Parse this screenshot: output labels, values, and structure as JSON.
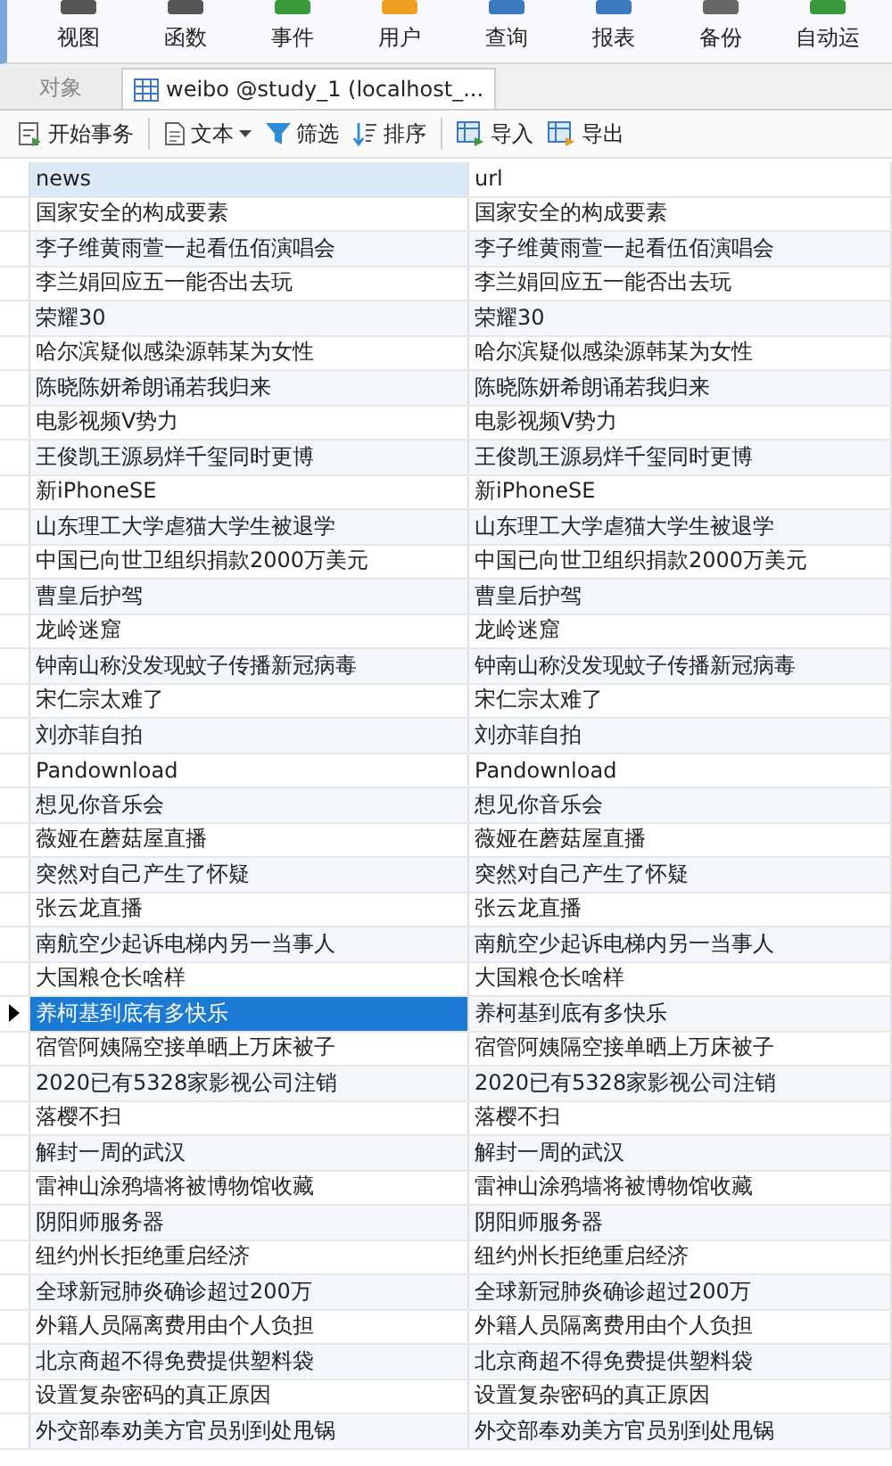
{
  "main_toolbar": [
    {
      "label": "视图"
    },
    {
      "label": "函数"
    },
    {
      "label": "事件"
    },
    {
      "label": "用户"
    },
    {
      "label": "查询"
    },
    {
      "label": "报表"
    },
    {
      "label": "备份"
    },
    {
      "label": "自动运"
    }
  ],
  "tabs": [
    {
      "label": "对象",
      "selected": false
    },
    {
      "label": "weibo @study_1 (localhost_...",
      "selected": true
    }
  ],
  "table_toolbar": [
    {
      "label": "开始事务",
      "kind": "transaction"
    },
    {
      "label": "文本",
      "kind": "text"
    },
    {
      "label": "筛选",
      "kind": "filter"
    },
    {
      "label": "排序",
      "kind": "sort"
    },
    {
      "label": "导入",
      "kind": "import"
    },
    {
      "label": "导出",
      "kind": "export"
    }
  ],
  "table": {
    "columns": [
      {
        "label": "news",
        "selected": true
      },
      {
        "label": "url",
        "selected": false
      }
    ],
    "rows": [
      {
        "cells": [
          "国家安全的构成要素",
          "国家安全的构成要素"
        ],
        "selected": false
      },
      {
        "cells": [
          "李子维黄雨萱一起看伍佰演唱会",
          "李子维黄雨萱一起看伍佰演唱会"
        ],
        "selected": false
      },
      {
        "cells": [
          "李兰娟回应五一能否出去玩",
          "李兰娟回应五一能否出去玩"
        ],
        "selected": false
      },
      {
        "cells": [
          "荣耀30",
          "荣耀30"
        ],
        "selected": false
      },
      {
        "cells": [
          "哈尔滨疑似感染源韩某为女性",
          "哈尔滨疑似感染源韩某为女性"
        ],
        "selected": false
      },
      {
        "cells": [
          "陈晓陈妍希朗诵若我归来",
          "陈晓陈妍希朗诵若我归来"
        ],
        "selected": false
      },
      {
        "cells": [
          "电影视频V势力",
          "电影视频V势力"
        ],
        "selected": false
      },
      {
        "cells": [
          "王俊凯王源易烊千玺同时更博",
          "王俊凯王源易烊千玺同时更博"
        ],
        "selected": false
      },
      {
        "cells": [
          "新iPhoneSE",
          "新iPhoneSE"
        ],
        "selected": false
      },
      {
        "cells": [
          "山东理工大学虐猫大学生被退学",
          "山东理工大学虐猫大学生被退学"
        ],
        "selected": false
      },
      {
        "cells": [
          "中国已向世卫组织捐款2000万美元",
          "中国已向世卫组织捐款2000万美元"
        ],
        "selected": false
      },
      {
        "cells": [
          "曹皇后护驾",
          "曹皇后护驾"
        ],
        "selected": false
      },
      {
        "cells": [
          "龙岭迷窟",
          "龙岭迷窟"
        ],
        "selected": false
      },
      {
        "cells": [
          "钟南山称没发现蚊子传播新冠病毒",
          "钟南山称没发现蚊子传播新冠病毒"
        ],
        "selected": false
      },
      {
        "cells": [
          "宋仁宗太难了",
          "宋仁宗太难了"
        ],
        "selected": false
      },
      {
        "cells": [
          "刘亦菲自拍",
          "刘亦菲自拍"
        ],
        "selected": false
      },
      {
        "cells": [
          "Pandownload",
          "Pandownload"
        ],
        "selected": false
      },
      {
        "cells": [
          "想见你音乐会",
          "想见你音乐会"
        ],
        "selected": false
      },
      {
        "cells": [
          "薇娅在蘑菇屋直播",
          "薇娅在蘑菇屋直播"
        ],
        "selected": false
      },
      {
        "cells": [
          "突然对自己产生了怀疑",
          "突然对自己产生了怀疑"
        ],
        "selected": false
      },
      {
        "cells": [
          "张云龙直播",
          "张云龙直播"
        ],
        "selected": false
      },
      {
        "cells": [
          "南航空少起诉电梯内另一当事人",
          "南航空少起诉电梯内另一当事人"
        ],
        "selected": false
      },
      {
        "cells": [
          "大国粮仓长啥样",
          "大国粮仓长啥样"
        ],
        "selected": false
      },
      {
        "cells": [
          "养柯基到底有多快乐",
          "养柯基到底有多快乐"
        ],
        "selected": true
      },
      {
        "cells": [
          "宿管阿姨隔空接单晒上万床被子",
          "宿管阿姨隔空接单晒上万床被子"
        ],
        "selected": false
      },
      {
        "cells": [
          "2020已有5328家影视公司注销",
          "2020已有5328家影视公司注销"
        ],
        "selected": false
      },
      {
        "cells": [
          "落樱不扫",
          "落樱不扫"
        ],
        "selected": false
      },
      {
        "cells": [
          "解封一周的武汉",
          "解封一周的武汉"
        ],
        "selected": false
      },
      {
        "cells": [
          "雷神山涂鸦墙将被博物馆收藏",
          "雷神山涂鸦墙将被博物馆收藏"
        ],
        "selected": false
      },
      {
        "cells": [
          "阴阳师服务器",
          "阴阳师服务器"
        ],
        "selected": false
      },
      {
        "cells": [
          "纽约州长拒绝重启经济",
          "纽约州长拒绝重启经济"
        ],
        "selected": false
      },
      {
        "cells": [
          "全球新冠肺炎确诊超过200万",
          "全球新冠肺炎确诊超过200万"
        ],
        "selected": false
      },
      {
        "cells": [
          "外籍人员隔离费用由个人负担",
          "外籍人员隔离费用由个人负担"
        ],
        "selected": false
      },
      {
        "cells": [
          "北京商超不得免费提供塑料袋",
          "北京商超不得免费提供塑料袋"
        ],
        "selected": false
      },
      {
        "cells": [
          "设置复杂密码的真正原因",
          "设置复杂密码的真正原因"
        ],
        "selected": false
      },
      {
        "cells": [
          "外交部奉劝美方官员别到处甩锅",
          "外交部奉劝美方官员别到处甩锅"
        ],
        "selected": false
      }
    ]
  }
}
